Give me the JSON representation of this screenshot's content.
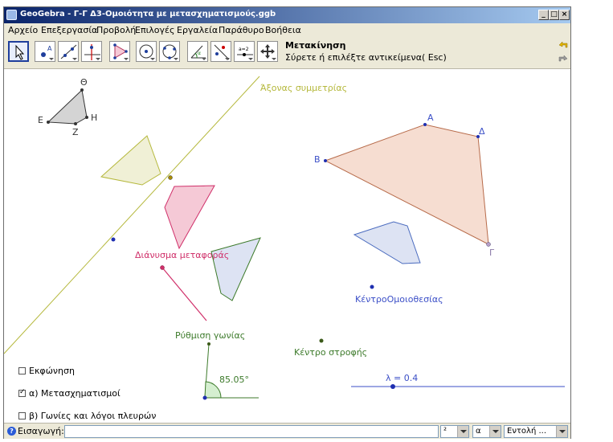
{
  "window": {
    "title": "GeoGebra - Γ-Γ Δ3-Ομοιότητα με μετασχηματισμούς.ggb",
    "min_label": "_",
    "max_label": "□",
    "close_label": "×"
  },
  "menu": {
    "items": [
      "Αρχείο",
      "Επεξεργασία",
      "Προβολή",
      "Επιλογές",
      "Εργαλεία",
      "Παράθυρο",
      "Βοήθεια"
    ]
  },
  "toolbar": {
    "active_tool_title": "Μετακίνηση",
    "active_tool_help": "Σύρετε ή επιλέξτε αντικείμενα( Esc)",
    "tools": [
      "move-tool",
      "point-tool",
      "line-tool",
      "perpendicular-tool",
      "polygon-tool",
      "circle-tool",
      "circle-three-points-tool",
      "angle-tool",
      "reflect-tool",
      "slider-tool",
      "move-view-tool"
    ],
    "slider_tool_label": "a=2",
    "point_tool_label": "A"
  },
  "canvas": {
    "symmetry_axis_label": "Άξονας συμμετρίας",
    "translation_vector_label": "Διάνυσμα μεταφοράς",
    "angle_setting_label": "Ρύθμιση γωνίας",
    "angle_value": "85.05°",
    "rotation_center_label": "Κέντρο στροφής",
    "homothety_center_label": "ΚέντροΟμοιοθεσίας",
    "lambda_label": "λ = 0.4",
    "small_triangle_labels": {
      "theta": "Θ",
      "epsilon": "Ε",
      "eta": "Η",
      "zeta": "Ζ"
    },
    "quad_labels": {
      "alpha": "Α",
      "beta": "Β",
      "gamma": "Γ",
      "delta": "Δ"
    },
    "checkboxes": [
      {
        "label": "Εκφώνηση",
        "checked": false
      },
      {
        "label": "α) Μετασχηματισμοί",
        "checked": true
      },
      {
        "label": "β) Γωνίες και λόγοι πλευρών",
        "checked": false
      }
    ]
  },
  "inputbar": {
    "label": "Εισαγωγή:",
    "value": "",
    "symbol_select": "²",
    "greek_select": "α",
    "command_select": "Εντολή ..."
  },
  "colors": {
    "axis_line": "#b5b83c",
    "yellow_fill": "#f0f0d6",
    "pink_fill": "#f5c9d6",
    "pink_stroke": "#d0306a",
    "blue_fill": "#dde3f3",
    "blue_stroke": "#4a6bbf",
    "orange_fill": "#f6ddd1",
    "orange_stroke": "#b76b4a",
    "green_label": "#3c7a2a",
    "blue_label": "#3b4fc7",
    "gray_fill": "#d9d9d9"
  }
}
